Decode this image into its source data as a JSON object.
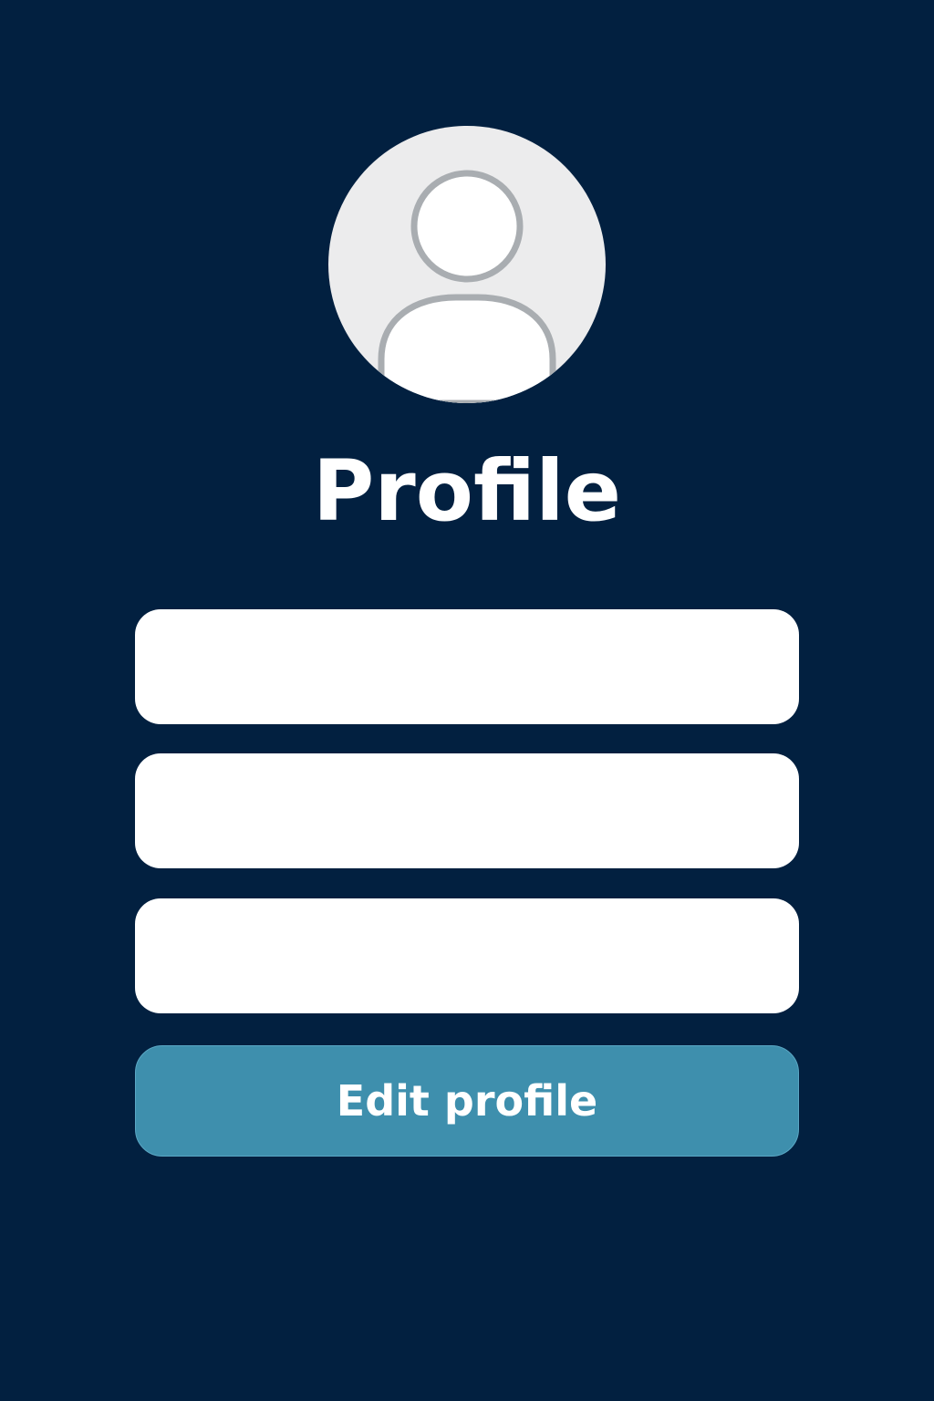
{
  "profile": {
    "title": "Profile",
    "avatar_icon": "user-placeholder-icon"
  },
  "fields": [
    {
      "value": "",
      "placeholder": ""
    },
    {
      "value": "",
      "placeholder": ""
    },
    {
      "value": "",
      "placeholder": ""
    }
  ],
  "actions": {
    "edit_label": "Edit profile"
  },
  "colors": {
    "background": "#022040",
    "field_background": "#ffffff",
    "button_background": "#3e8fad",
    "avatar_background": "#ececed",
    "avatar_outline": "#a9adb1"
  }
}
